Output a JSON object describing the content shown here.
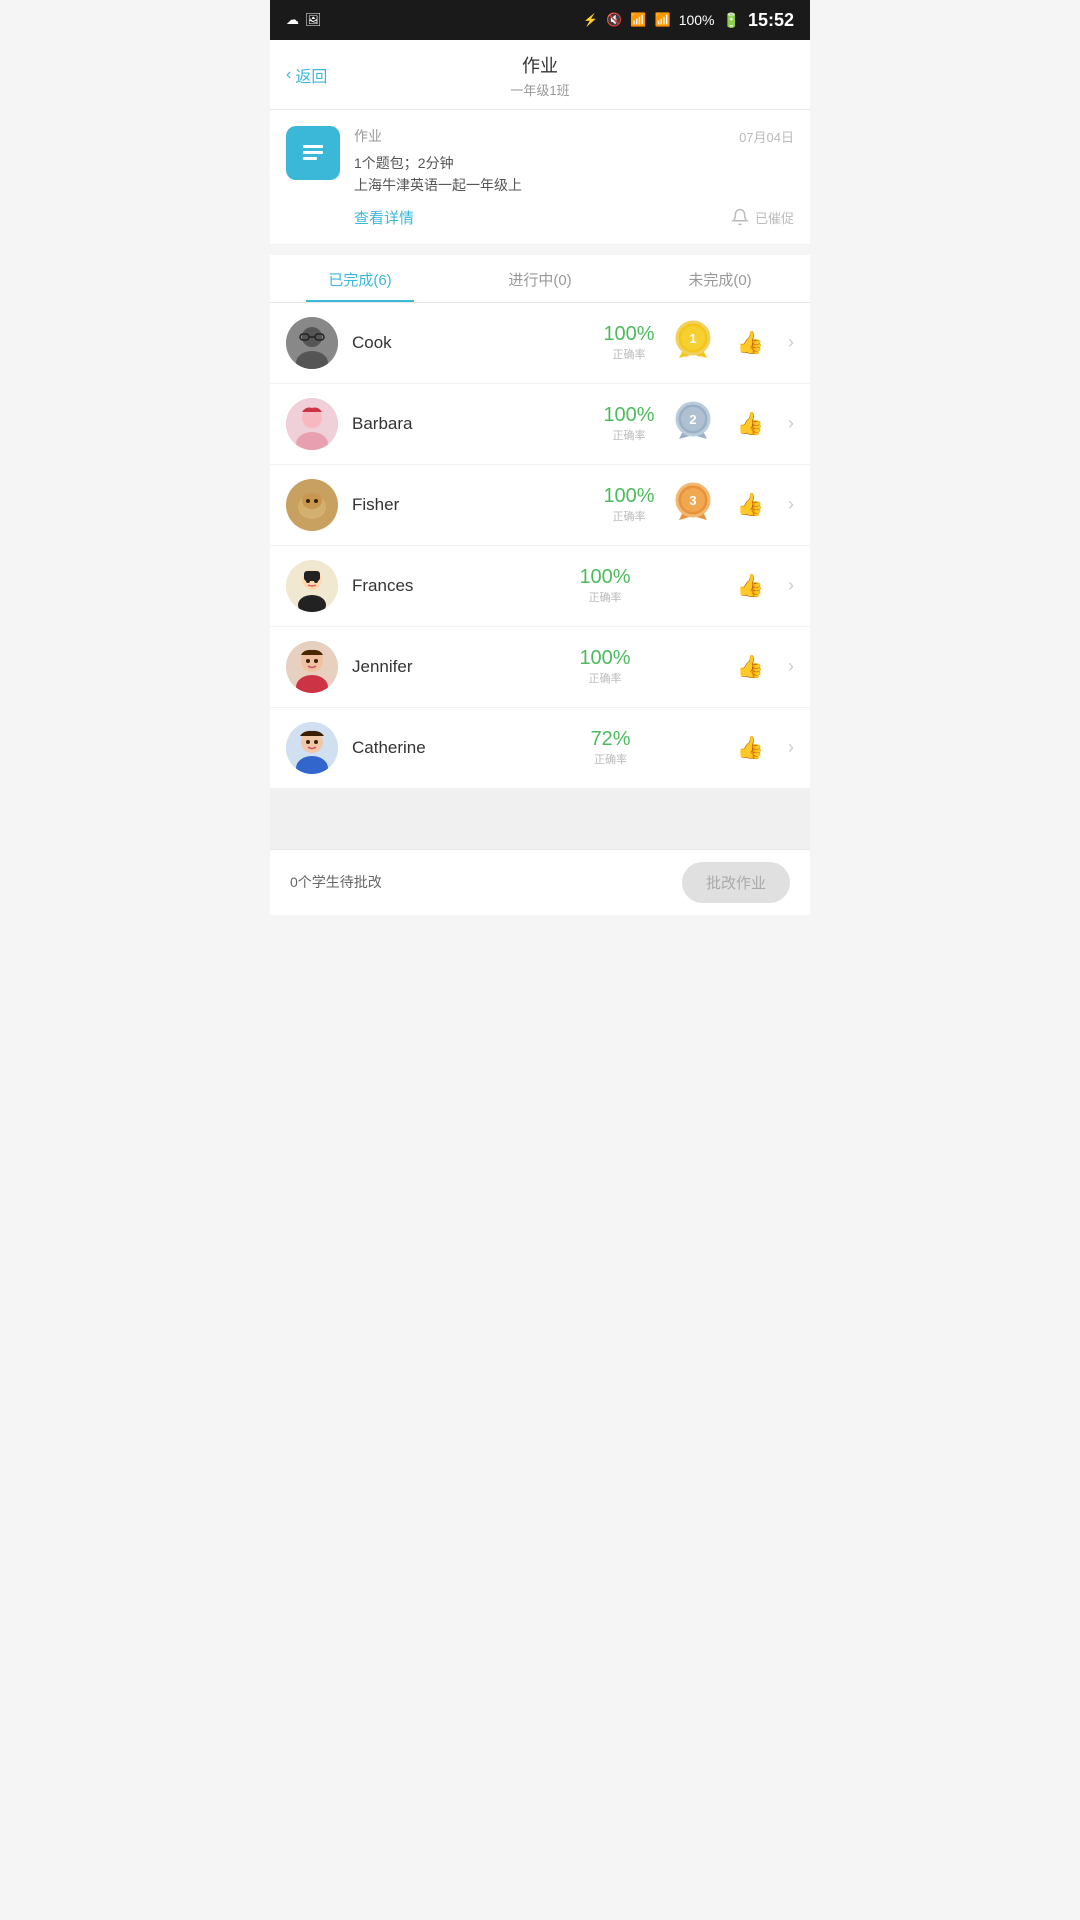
{
  "statusBar": {
    "time": "15:52",
    "battery": "100%",
    "icons": [
      "cloud",
      "image",
      "bluetooth",
      "mute",
      "wifi",
      "signal"
    ]
  },
  "header": {
    "backLabel": "返回",
    "title": "作业",
    "subtitle": "一年级1班"
  },
  "assignment": {
    "label": "作业",
    "date": "07月04日",
    "desc1": "1个题包；2分钟",
    "desc2": "上海牛津英语一起一年级上",
    "viewDetail": "查看详情",
    "remind": "已催促"
  },
  "tabs": [
    {
      "label": "已完成(6)",
      "active": true
    },
    {
      "label": "进行中(0)",
      "active": false
    },
    {
      "label": "未完成(0)",
      "active": false
    }
  ],
  "students": [
    {
      "name": "Cook",
      "score": "100%",
      "scoreLabel": "正确率",
      "medal": 1,
      "avatarEmoji": "🕶"
    },
    {
      "name": "Barbara",
      "score": "100%",
      "scoreLabel": "正确率",
      "medal": 2,
      "avatarEmoji": "👧"
    },
    {
      "name": "Fisher",
      "score": "100%",
      "scoreLabel": "正确率",
      "medal": 3,
      "avatarEmoji": "🐶"
    },
    {
      "name": "Frances",
      "score": "100%",
      "scoreLabel": "正确率",
      "medal": 0,
      "avatarEmoji": "🧒"
    },
    {
      "name": "Jennifer",
      "score": "100%",
      "scoreLabel": "正确率",
      "medal": 0,
      "avatarEmoji": "👶"
    },
    {
      "name": "Catherine",
      "score": "72%",
      "scoreLabel": "正确率",
      "medal": 0,
      "avatarEmoji": "🧒"
    }
  ],
  "bottom": {
    "pendingLabel": "0个学生待批改",
    "actionLabel": "批改作业"
  }
}
